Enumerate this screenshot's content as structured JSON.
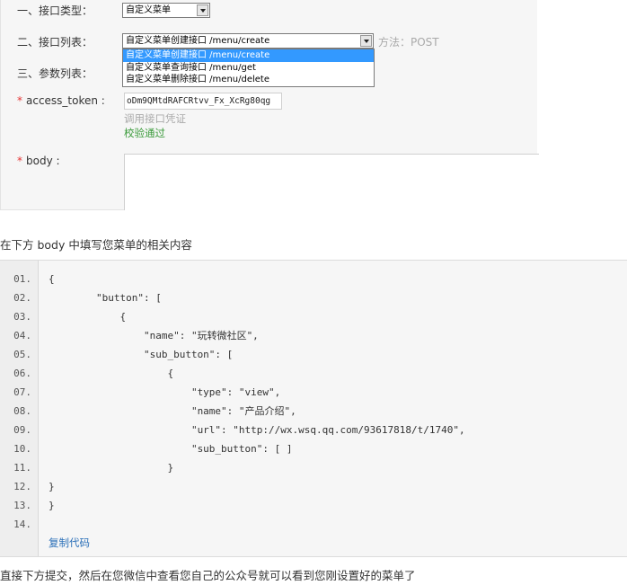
{
  "form": {
    "api_type_label": "一、接口类型：",
    "api_type_value": "自定义菜单",
    "api_list_label": "二、接口列表：",
    "api_list_value": "自定义菜单创建接口 /menu/create",
    "api_options": [
      "自定义菜单创建接口 /menu/create",
      "自定义菜单查询接口 /menu/get",
      "自定义菜单删除接口 /menu/delete"
    ],
    "method_text": "方法：POST",
    "params_label": "三、参数列表：",
    "required_mark": "*",
    "token_label": "access_token :",
    "token_value": "oDm9QMtdRAFCRtvv_Fx_XcRg80qg",
    "token_hint": "调用接口凭证",
    "token_status": "校验通过",
    "body_label": "body :",
    "body_value": ""
  },
  "instruction_top": "在下方 body 中填写您菜单的相关内容",
  "code": {
    "line_numbers": [
      "01.",
      "02.",
      "03.",
      "04.",
      "05.",
      "06.",
      "07.",
      "08.",
      "09.",
      "10.",
      "11.",
      "12.",
      "13.",
      "14."
    ],
    "lines": [
      "{",
      "        \"button\": [",
      "            {",
      "                \"name\": \"玩转微社区\",",
      "                \"sub_button\": [",
      "                    {",
      "                        \"type\": \"view\",",
      "                        \"name\": \"产品介绍\",",
      "                        \"url\": \"http://wx.wsq.qq.com/93617818/t/1740\",",
      "                        \"sub_button\": [ ]",
      "                    }",
      "}",
      "}",
      ""
    ],
    "copy_label": "复制代码"
  },
  "instruction_bottom": "直接下方提交，然后在您微信中查看您自己的公众号就可以看到您刚设置好的菜单了",
  "colors": {
    "required": "#e53333",
    "status_ok": "#3a9a3a",
    "selected_option": "#3399ff",
    "link": "#2a6fb8"
  },
  "icons": [
    "dropdown-arrow-icon"
  ]
}
